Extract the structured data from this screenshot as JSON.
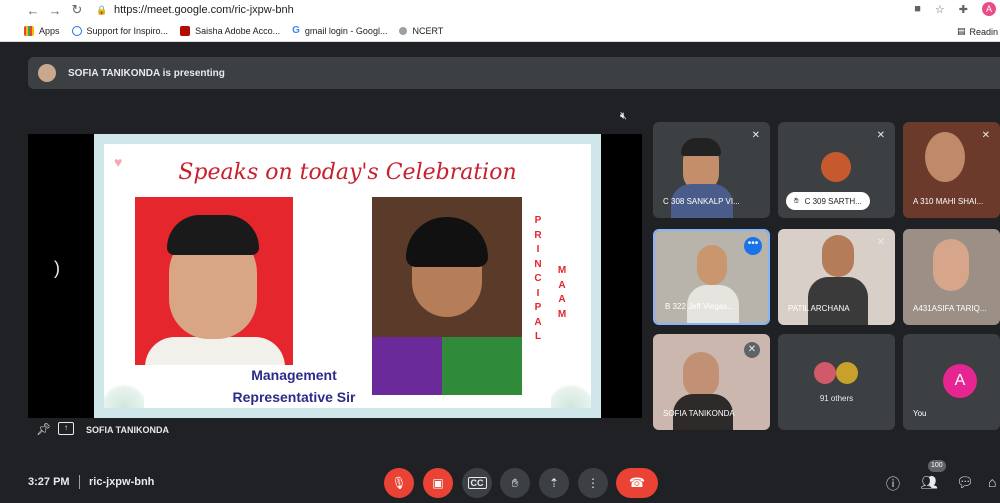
{
  "browser": {
    "url": "https://meet.google.com/ric-jxpw-bnh",
    "bookmarks": [
      {
        "label": "Apps"
      },
      {
        "label": "Support for Inspiro..."
      },
      {
        "label": "Saisha Adobe Acco..."
      },
      {
        "label": "gmail login - Googl..."
      },
      {
        "label": "NCERT"
      }
    ],
    "reading_list": "Readin",
    "profile_initial": "A"
  },
  "presentation": {
    "banner": "SOFIA TANIKONDA is presenting",
    "presenter_label": "SOFIA TANIKONDA",
    "slide": {
      "title": "Speaks on today's Celebration",
      "caption_line1": "Management",
      "caption_line2": "Representative Sir",
      "vertical_1": "PRINCIPAL",
      "vertical_2": "MAAM"
    }
  },
  "participants": [
    {
      "name": "C 308 SANKALP VI..."
    },
    {
      "name": "C 309 SARTH..."
    },
    {
      "name": "A 310 MAHI SHAI..."
    },
    {
      "name": "B 322 Jeff Viegas..."
    },
    {
      "name": "PATIL ARCHANA"
    },
    {
      "name": "A431ASIFA TARIQ..."
    },
    {
      "name": "SOFIA TANIKONDA"
    },
    {
      "name": "91 others"
    },
    {
      "name": "You",
      "initial": "A"
    }
  ],
  "bottom_bar": {
    "time": "3:27 PM",
    "meeting_code": "ric-jxpw-bnh",
    "people_count": "100"
  },
  "colors": {
    "background": "#202124",
    "tile": "#3c4043",
    "danger": "#ea4335",
    "accent": "#1a73e8"
  }
}
